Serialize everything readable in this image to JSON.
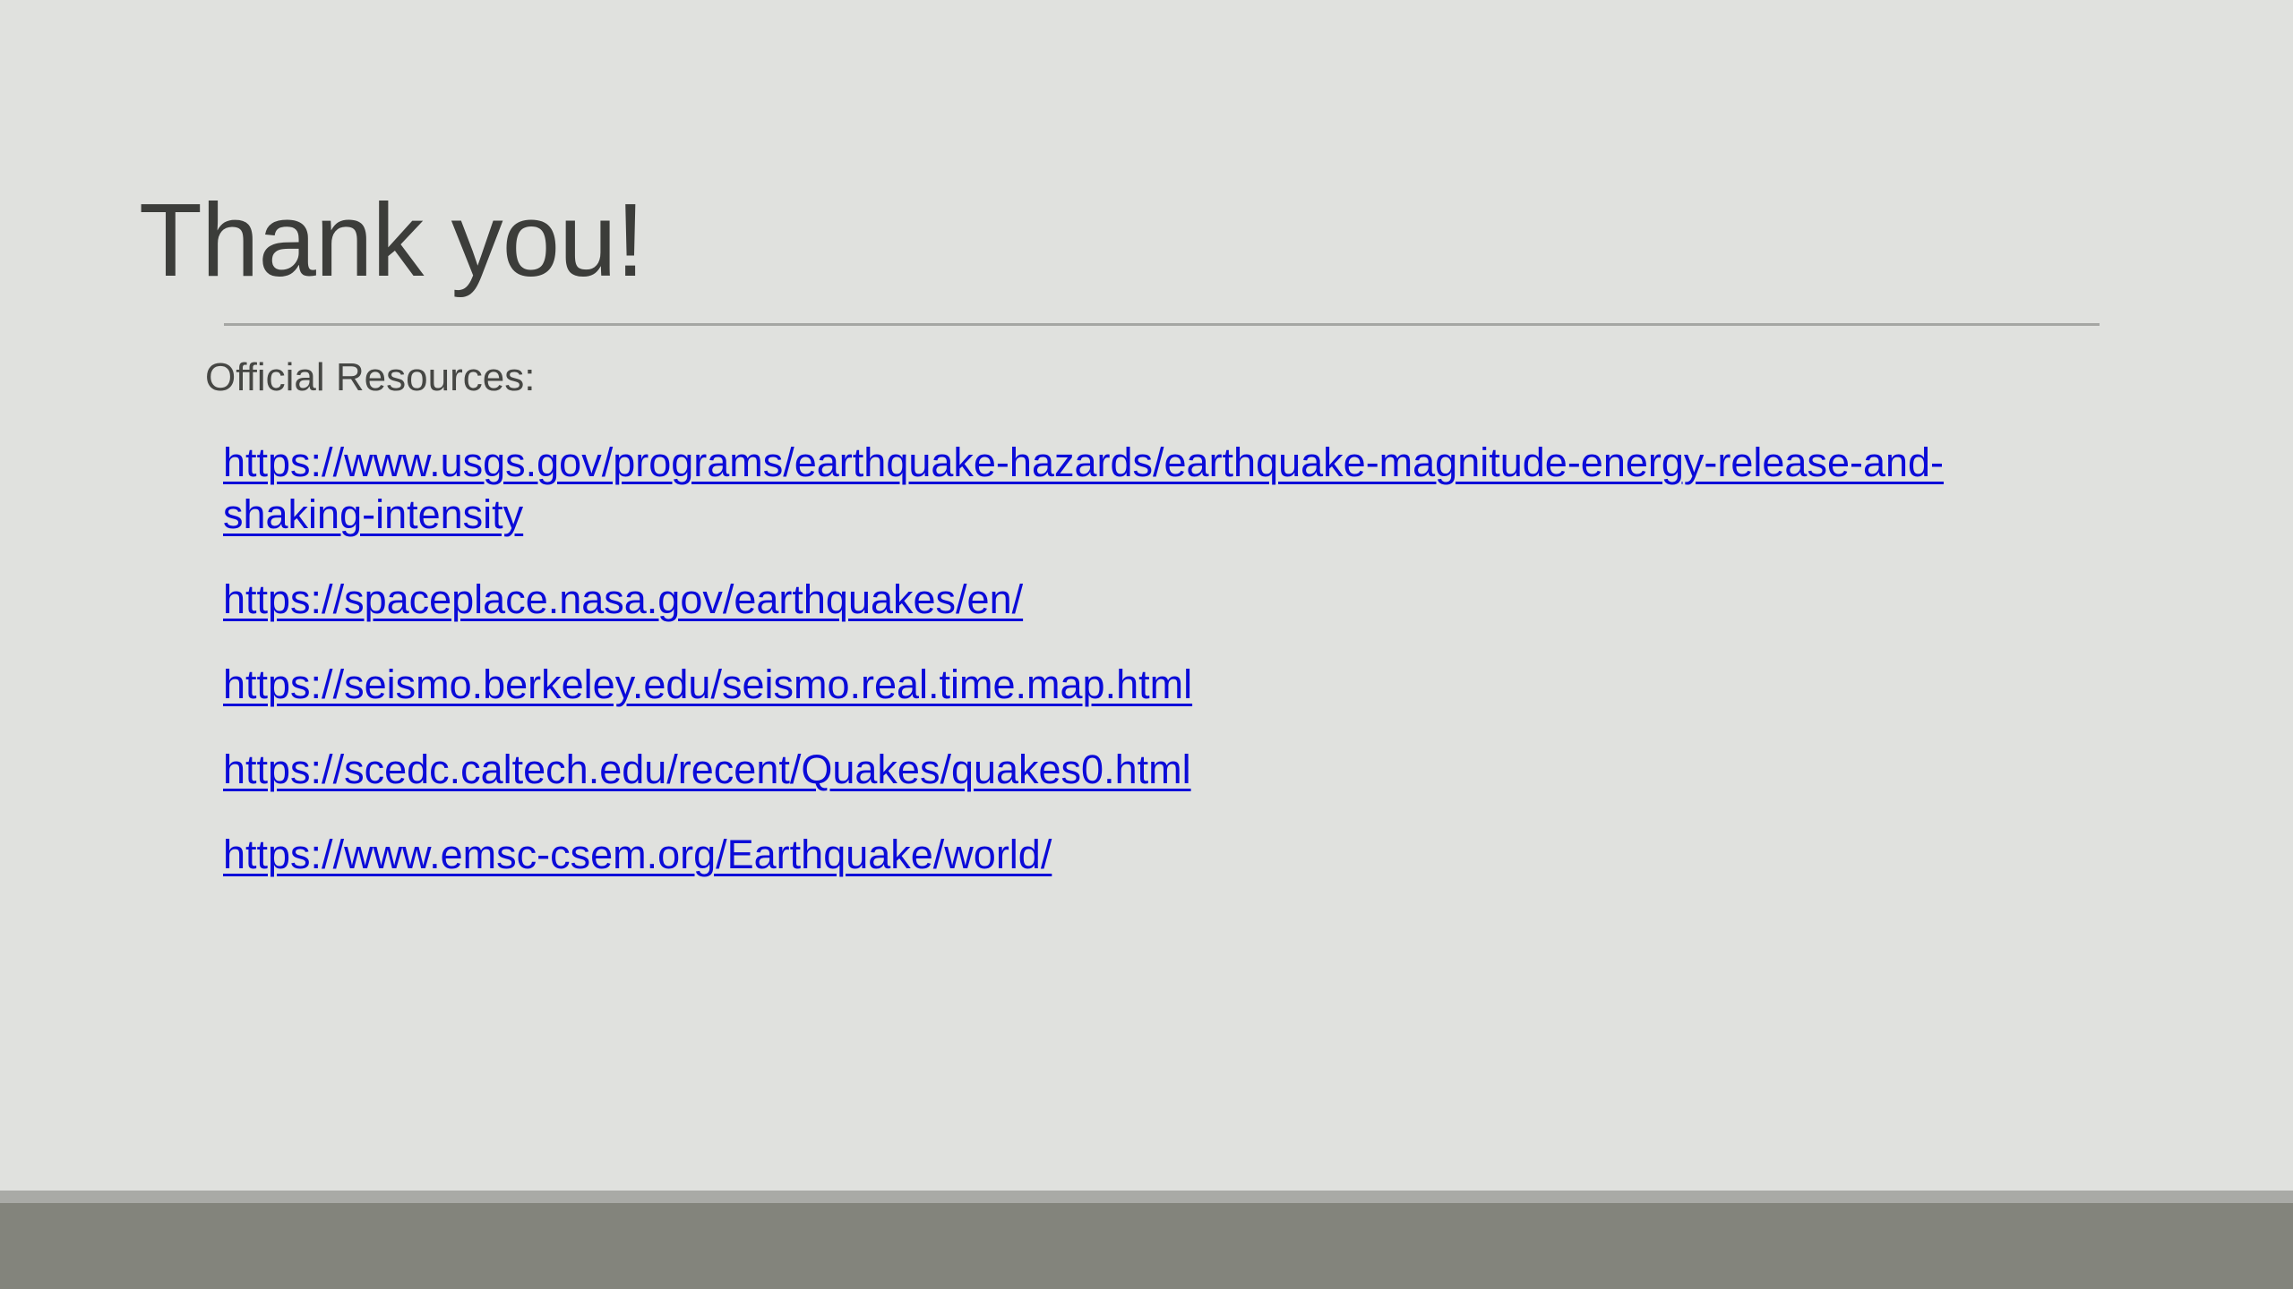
{
  "slide": {
    "title": "Thank you!",
    "resources_label": "Official Resources:",
    "links": [
      "https://www.usgs.gov/programs/earthquake-hazards/earthquake-magnitude-energy-release-and-shaking-intensity",
      "https://spaceplace.nasa.gov/earthquakes/en/",
      "https://seismo.berkeley.edu/seismo.real.time.map.html",
      "https://scedc.caltech.edu/recent/Quakes/quakes0.html",
      "https://www.emsc-csem.org/Earthquake/world/"
    ]
  },
  "colors": {
    "background": "#e0e1de",
    "title_text": "#3c3d3a",
    "body_text": "#464744",
    "link": "#0b0bd8",
    "divider": "#a5a6a3",
    "footer_bar": "#83847c",
    "footer_stripe": "#a9aaa6"
  }
}
